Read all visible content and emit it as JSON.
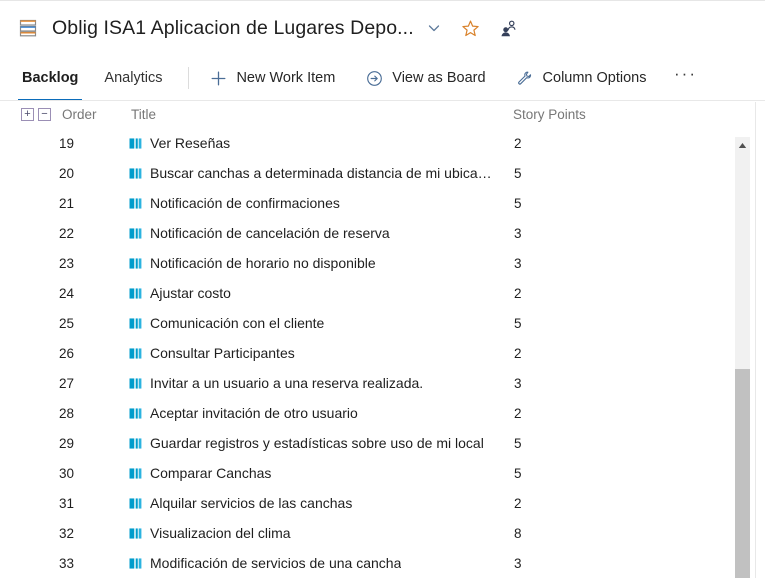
{
  "header": {
    "project_icon": "backlog-stack-icon",
    "title": "Oblig ISA1 Aplicacion de Lugares Depo...",
    "chevron_icon": "chevron-down-icon",
    "favorite_icon": "star-outline-icon",
    "team_icon": "people-team-icon"
  },
  "toolbar": {
    "pivots": [
      {
        "label": "Backlog",
        "active": true
      },
      {
        "label": "Analytics",
        "active": false
      }
    ],
    "buttons": [
      {
        "label": "New Work Item",
        "icon": "plus-icon"
      },
      {
        "label": "View as Board",
        "icon": "arrow-right-circle-icon"
      },
      {
        "label": "Column Options",
        "icon": "wrench-icon"
      }
    ],
    "more_label": "···",
    "more_icon": "more-horizontal-icon"
  },
  "grid": {
    "expand_label": "+",
    "collapse_label": "−",
    "columns": {
      "order": "Order",
      "title": "Title",
      "story_points": "Story Points"
    },
    "rows": [
      {
        "order": "19",
        "title": "Ver Reseñas",
        "story_points": "2",
        "icon": "user-story-icon"
      },
      {
        "order": "20",
        "title": "Buscar canchas a determinada distancia de mi ubicación act...",
        "story_points": "5",
        "icon": "user-story-icon"
      },
      {
        "order": "21",
        "title": "Notificación de confirmaciones",
        "story_points": "5",
        "icon": "user-story-icon"
      },
      {
        "order": "22",
        "title": "Notificación de cancelación de reserva",
        "story_points": "3",
        "icon": "user-story-icon"
      },
      {
        "order": "23",
        "title": "Notificación de horario no disponible",
        "story_points": "3",
        "icon": "user-story-icon"
      },
      {
        "order": "24",
        "title": "Ajustar costo",
        "story_points": "2",
        "icon": "user-story-icon"
      },
      {
        "order": "25",
        "title": "Comunicación con el cliente",
        "story_points": "5",
        "icon": "user-story-icon"
      },
      {
        "order": "26",
        "title": "Consultar Participantes",
        "story_points": "2",
        "icon": "user-story-icon"
      },
      {
        "order": "27",
        "title": "Invitar a un usuario a una reserva realizada.",
        "story_points": "3",
        "icon": "user-story-icon"
      },
      {
        "order": "28",
        "title": "Aceptar invitación de otro usuario",
        "story_points": "2",
        "icon": "user-story-icon"
      },
      {
        "order": "29",
        "title": "Guardar registros y estadísticas sobre uso de mi local",
        "story_points": "5",
        "icon": "user-story-icon"
      },
      {
        "order": "30",
        "title": "Comparar Canchas",
        "story_points": "5",
        "icon": "user-story-icon"
      },
      {
        "order": "31",
        "title": "Alquilar servicios de las canchas",
        "story_points": "2",
        "icon": "user-story-icon"
      },
      {
        "order": "32",
        "title": "Visualizacion del clima",
        "story_points": "8",
        "icon": "user-story-icon"
      },
      {
        "order": "33",
        "title": "Modificación de servicios de una cancha",
        "story_points": "3",
        "icon": "user-story-icon"
      }
    ]
  },
  "scrollbar": {
    "up_icon": "scroll-up-arrow-icon"
  },
  "colors": {
    "accent": "#0b6cba",
    "work_item_icon": "#009ccc",
    "favorite": "#d9822b",
    "scroll_thumb": "#c1c1c1"
  }
}
